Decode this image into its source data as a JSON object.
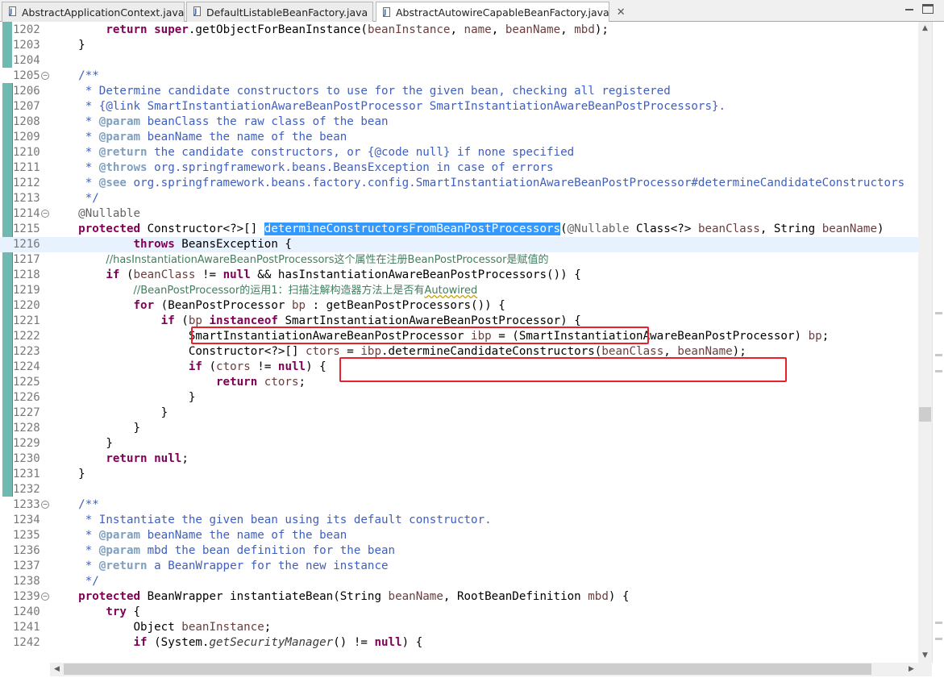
{
  "tabs": [
    {
      "label": "AbstractApplicationContext.java",
      "active": false
    },
    {
      "label": "DefaultListableBeanFactory.java",
      "active": false
    },
    {
      "label": "AbstractAutowireCapableBeanFactory.java",
      "active": true
    }
  ],
  "tab_close_glyph": "✕",
  "colors": {
    "keyword": "#7f0055",
    "javadoc": "#3f5fbf",
    "comment": "#3f7f5f",
    "selection": "#3399ff",
    "annotation_box": "#e8212a",
    "quick_diff": "#6fb9b0"
  },
  "editor": {
    "current_line": "1216",
    "lines": [
      {
        "n": "1202",
        "segs": [
          [
            "",
            "        "
          ],
          [
            "k",
            "return"
          ],
          [
            "",
            " "
          ],
          [
            "k",
            "super"
          ],
          [
            "",
            ".getObjectForBeanInstance("
          ],
          [
            "var",
            "beanInstance"
          ],
          [
            "",
            ", "
          ],
          [
            "var",
            "name"
          ],
          [
            "",
            ", "
          ],
          [
            "var",
            "beanName"
          ],
          [
            "",
            ", "
          ],
          [
            "var",
            "mbd"
          ],
          [
            "",
            ");"
          ]
        ]
      },
      {
        "n": "1203",
        "segs": [
          [
            "",
            "    }"
          ]
        ]
      },
      {
        "n": "1204",
        "segs": []
      },
      {
        "n": "1205",
        "fold": true,
        "segs": [
          [
            "jd",
            "    /**"
          ]
        ]
      },
      {
        "n": "1206",
        "segs": [
          [
            "jd",
            "     * Determine candidate constructors to use for the given bean, checking all registered"
          ]
        ]
      },
      {
        "n": "1207",
        "segs": [
          [
            "jd",
            "     * {@link SmartInstantiationAwareBeanPostProcessor SmartInstantiationAwareBeanPostProcessors}."
          ]
        ]
      },
      {
        "n": "1208",
        "segs": [
          [
            "jd",
            "     * "
          ],
          [
            "jt",
            "@param"
          ],
          [
            "jd",
            " beanClass the raw class of the bean"
          ]
        ]
      },
      {
        "n": "1209",
        "segs": [
          [
            "jd",
            "     * "
          ],
          [
            "jt",
            "@param"
          ],
          [
            "jd",
            " beanName the name of the bean"
          ]
        ]
      },
      {
        "n": "1210",
        "segs": [
          [
            "jd",
            "     * "
          ],
          [
            "jt",
            "@return"
          ],
          [
            "jd",
            " the candidate constructors, or {@code null} if none specified"
          ]
        ]
      },
      {
        "n": "1211",
        "segs": [
          [
            "jd",
            "     * "
          ],
          [
            "jt",
            "@throws"
          ],
          [
            "jd",
            " org.springframework.beans.BeansException in case of errors"
          ]
        ]
      },
      {
        "n": "1212",
        "segs": [
          [
            "jd",
            "     * "
          ],
          [
            "jt",
            "@see"
          ],
          [
            "jd",
            " org.springframework.beans.factory.config.SmartInstantiationAwareBeanPostProcessor#determineCandidateConstructors"
          ]
        ]
      },
      {
        "n": "1213",
        "segs": [
          [
            "jd",
            "     */"
          ]
        ]
      },
      {
        "n": "1214",
        "fold": true,
        "segs": [
          [
            "an",
            "    @Nullable"
          ]
        ]
      },
      {
        "n": "1215",
        "segs": [
          [
            "",
            "    "
          ],
          [
            "k",
            "protected"
          ],
          [
            "",
            " Constructor<?>[] "
          ],
          [
            "sel",
            "determineConstructorsFromBeanPostProcessors"
          ],
          [
            "",
            "("
          ],
          [
            "an",
            "@Nullable"
          ],
          [
            "",
            " Class<?> "
          ],
          [
            "var",
            "beanClass"
          ],
          [
            "",
            ", String "
          ],
          [
            "var",
            "beanName"
          ],
          [
            "",
            ")"
          ]
        ]
      },
      {
        "n": "1216",
        "segs": [
          [
            "",
            "            "
          ],
          [
            "k",
            "throws"
          ],
          [
            "",
            " BeansException {"
          ]
        ]
      },
      {
        "n": "1217",
        "segs": [
          [
            "",
            "        "
          ],
          [
            "cm",
            "//hasInstantiationAwareBeanPostProcessors这个属性在注册BeanPostProcessor是赋值的"
          ]
        ]
      },
      {
        "n": "1218",
        "segs": [
          [
            "",
            "        "
          ],
          [
            "k",
            "if"
          ],
          [
            "",
            " ("
          ],
          [
            "var",
            "beanClass"
          ],
          [
            "",
            " != "
          ],
          [
            "k",
            "null"
          ],
          [
            "",
            " && hasInstantiationAwareBeanPostProcessors()) {"
          ]
        ]
      },
      {
        "n": "1219",
        "segs": [
          [
            "",
            "            "
          ],
          [
            "cm",
            "//BeanPostProcessor的运用1：扫描注解构造器方法上是否有"
          ],
          [
            "cm sq",
            "Autowired"
          ]
        ]
      },
      {
        "n": "1220",
        "segs": [
          [
            "",
            "            "
          ],
          [
            "k",
            "for"
          ],
          [
            "",
            " (BeanPostProcessor "
          ],
          [
            "var",
            "bp"
          ],
          [
            "",
            " : getBeanPostProcessors()) {"
          ]
        ]
      },
      {
        "n": "1221",
        "segs": [
          [
            "",
            "                "
          ],
          [
            "k",
            "if"
          ],
          [
            "",
            " ("
          ],
          [
            "var",
            "bp"
          ],
          [
            "",
            " "
          ],
          [
            "k",
            "instanceof"
          ],
          [
            "",
            " SmartInstantiationAwareBeanPostProcessor) {"
          ]
        ]
      },
      {
        "n": "1222",
        "segs": [
          [
            "",
            "                    SmartInstantiationAwareBeanPostProcessor "
          ],
          [
            "var",
            "ibp"
          ],
          [
            "",
            " = (SmartInstantiationAwareBeanPostProcessor) "
          ],
          [
            "var",
            "bp"
          ],
          [
            "",
            ";"
          ]
        ]
      },
      {
        "n": "1223",
        "segs": [
          [
            "",
            "                    Constructor<?>[] "
          ],
          [
            "var",
            "ctors"
          ],
          [
            "",
            " = "
          ],
          [
            "var",
            "ibp"
          ],
          [
            "",
            ".determineCandidateConstructors("
          ],
          [
            "var",
            "beanClass"
          ],
          [
            "",
            ", "
          ],
          [
            "var",
            "beanName"
          ],
          [
            "",
            ");"
          ]
        ]
      },
      {
        "n": "1224",
        "segs": [
          [
            "",
            "                    "
          ],
          [
            "k",
            "if"
          ],
          [
            "",
            " ("
          ],
          [
            "var",
            "ctors"
          ],
          [
            "",
            " != "
          ],
          [
            "k",
            "null"
          ],
          [
            "",
            ") {"
          ]
        ]
      },
      {
        "n": "1225",
        "segs": [
          [
            "",
            "                        "
          ],
          [
            "k",
            "return"
          ],
          [
            "",
            " "
          ],
          [
            "var",
            "ctors"
          ],
          [
            "",
            ";"
          ]
        ]
      },
      {
        "n": "1226",
        "segs": [
          [
            "",
            "                    }"
          ]
        ]
      },
      {
        "n": "1227",
        "segs": [
          [
            "",
            "                }"
          ]
        ]
      },
      {
        "n": "1228",
        "segs": [
          [
            "",
            "            }"
          ]
        ]
      },
      {
        "n": "1229",
        "segs": [
          [
            "",
            "        }"
          ]
        ]
      },
      {
        "n": "1230",
        "segs": [
          [
            "",
            "        "
          ],
          [
            "k",
            "return"
          ],
          [
            "",
            " "
          ],
          [
            "k",
            "null"
          ],
          [
            "",
            ";"
          ]
        ]
      },
      {
        "n": "1231",
        "segs": [
          [
            "",
            "    }"
          ]
        ]
      },
      {
        "n": "1232",
        "segs": []
      },
      {
        "n": "1233",
        "fold": true,
        "segs": [
          [
            "jd",
            "    /**"
          ]
        ]
      },
      {
        "n": "1234",
        "segs": [
          [
            "jd",
            "     * Instantiate the given bean using its default constructor."
          ]
        ]
      },
      {
        "n": "1235",
        "segs": [
          [
            "jd",
            "     * "
          ],
          [
            "jt",
            "@param"
          ],
          [
            "jd",
            " beanName the name of the bean"
          ]
        ]
      },
      {
        "n": "1236",
        "segs": [
          [
            "jd",
            "     * "
          ],
          [
            "jt",
            "@param"
          ],
          [
            "jd",
            " mbd the bean definition for the bean"
          ]
        ]
      },
      {
        "n": "1237",
        "segs": [
          [
            "jd",
            "     * "
          ],
          [
            "jt",
            "@return"
          ],
          [
            "jd",
            " a BeanWrapper for the new instance"
          ]
        ]
      },
      {
        "n": "1238",
        "segs": [
          [
            "jd",
            "     */"
          ]
        ]
      },
      {
        "n": "1239",
        "fold": true,
        "segs": [
          [
            "",
            "    "
          ],
          [
            "k",
            "protected"
          ],
          [
            "",
            " BeanWrapper instantiateBean(String "
          ],
          [
            "var",
            "beanName"
          ],
          [
            "",
            ", RootBeanDefinition "
          ],
          [
            "var",
            "mbd"
          ],
          [
            "",
            ") {"
          ]
        ]
      },
      {
        "n": "1240",
        "segs": [
          [
            "",
            "        "
          ],
          [
            "k",
            "try"
          ],
          [
            "",
            " {"
          ]
        ]
      },
      {
        "n": "1241",
        "segs": [
          [
            "",
            "            Object "
          ],
          [
            "var",
            "beanInstance"
          ],
          [
            "",
            ";"
          ]
        ]
      },
      {
        "n": "1242",
        "segs": [
          [
            "",
            "            "
          ],
          [
            "k",
            "if"
          ],
          [
            "",
            " (System."
          ],
          [
            "ff",
            "getSecurityManager"
          ],
          [
            "",
            "() != "
          ],
          [
            "k",
            "null"
          ],
          [
            "",
            ") {"
          ]
        ]
      }
    ]
  }
}
